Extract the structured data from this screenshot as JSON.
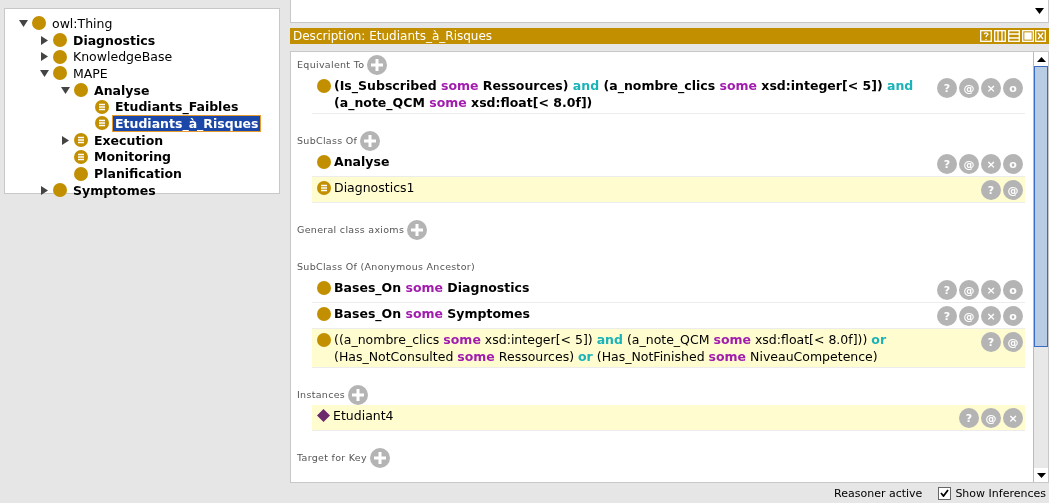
{
  "tree": [
    {
      "label": "owl:Thing",
      "kind": "class",
      "bold": false,
      "expanded": true,
      "selected": false,
      "children": [
        {
          "label": "Diagnostics",
          "kind": "class",
          "bold": true,
          "expanded": false,
          "selected": false
        },
        {
          "label": "KnowledgeBase",
          "kind": "class",
          "bold": false,
          "expanded": false,
          "selected": false
        },
        {
          "label": "MAPE",
          "kind": "class",
          "bold": false,
          "expanded": true,
          "selected": false,
          "children": [
            {
              "label": "Analyse",
              "kind": "class",
              "bold": true,
              "expanded": true,
              "selected": false,
              "children": [
                {
                  "label": "Etudiants_Faibles",
                  "kind": "defined",
                  "bold": true,
                  "selected": false
                },
                {
                  "label": "Etudiants_à_Risques",
                  "kind": "defined",
                  "bold": true,
                  "selected": true
                }
              ]
            },
            {
              "label": "Execution",
              "kind": "defined",
              "bold": true,
              "expanded": false,
              "selected": false
            },
            {
              "label": "Monitoring",
              "kind": "defined",
              "bold": true,
              "selected": false
            },
            {
              "label": "Planification",
              "kind": "class",
              "bold": true,
              "selected": false
            }
          ]
        },
        {
          "label": "Symptomes",
          "kind": "class",
          "bold": true,
          "expanded": false,
          "selected": false
        }
      ]
    }
  ],
  "description": {
    "title": "Description: Etudiants_à_Risques",
    "sections": [
      {
        "title": "Equivalent To",
        "add": true,
        "rows": [
          {
            "kind": "class",
            "bold": true,
            "inferred": false,
            "buttons": [
              "?",
              "@",
              "×",
              "o"
            ],
            "lines": [
              [
                {
                  "text": "(Is_Subscribed ",
                  "kind": "name"
                },
                {
                  "text": "some",
                  "kind": "some"
                },
                {
                  "text": " Ressources) ",
                  "kind": "name"
                },
                {
                  "text": "and",
                  "kind": "and"
                },
                {
                  "text": " (a_nombre_clics ",
                  "kind": "name"
                },
                {
                  "text": "some",
                  "kind": "some"
                },
                {
                  "text": " xsd:integer[< 5]) ",
                  "kind": "name"
                },
                {
                  "text": "and",
                  "kind": "and"
                }
              ],
              [
                {
                  "text": "(a_note_QCM ",
                  "kind": "name"
                },
                {
                  "text": "some",
                  "kind": "some"
                },
                {
                  "text": " xsd:float[< 8.0f])",
                  "kind": "name"
                }
              ]
            ]
          }
        ]
      },
      {
        "title": "SubClass Of",
        "add": true,
        "rows": [
          {
            "kind": "class",
            "bold": true,
            "inferred": false,
            "buttons": [
              "?",
              "@",
              "×",
              "o"
            ],
            "lines": [
              [
                {
                  "text": "Analyse",
                  "kind": "name"
                }
              ]
            ]
          },
          {
            "kind": "defined",
            "bold": false,
            "inferred": true,
            "buttons": [
              "?",
              "@"
            ],
            "lines": [
              [
                {
                  "text": "Diagnostics1",
                  "kind": "name"
                }
              ]
            ]
          }
        ]
      },
      {
        "title": "General class axioms",
        "add": true
      },
      {
        "title": "SubClass Of (Anonymous Ancestor)",
        "add": false,
        "rows": [
          {
            "kind": "class",
            "bold": true,
            "inferred": false,
            "buttons": [
              "?",
              "@",
              "×",
              "o"
            ],
            "lines": [
              [
                {
                  "text": "Bases_On ",
                  "kind": "name"
                },
                {
                  "text": "some",
                  "kind": "some"
                },
                {
                  "text": "  Diagnostics",
                  "kind": "name"
                }
              ]
            ]
          },
          {
            "kind": "class",
            "bold": true,
            "inferred": false,
            "buttons": [
              "?",
              "@",
              "×",
              "o"
            ],
            "lines": [
              [
                {
                  "text": "Bases_On ",
                  "kind": "name"
                },
                {
                  "text": "some",
                  "kind": "some"
                },
                {
                  "text": " Symptomes",
                  "kind": "name"
                }
              ]
            ]
          },
          {
            "kind": "class",
            "bold": false,
            "inferred": true,
            "buttons": [
              "?",
              "@"
            ],
            "lines": [
              [
                {
                  "text": "((a_nombre_clics ",
                  "kind": "name"
                },
                {
                  "text": "some",
                  "kind": "some"
                },
                {
                  "text": " xsd:integer[< 5]) ",
                  "kind": "name"
                },
                {
                  "text": "and",
                  "kind": "and"
                },
                {
                  "text": " (a_note_QCM ",
                  "kind": "name"
                },
                {
                  "text": "some",
                  "kind": "some"
                },
                {
                  "text": " xsd:float[< 8.0f])) ",
                  "kind": "name"
                },
                {
                  "text": "or",
                  "kind": "and"
                }
              ],
              [
                {
                  "text": "(Has_NotConsulted ",
                  "kind": "name"
                },
                {
                  "text": "some",
                  "kind": "some"
                },
                {
                  "text": " Ressources) ",
                  "kind": "name"
                },
                {
                  "text": "or",
                  "kind": "and"
                },
                {
                  "text": " (Has_NotFinished ",
                  "kind": "name"
                },
                {
                  "text": "some",
                  "kind": "some"
                },
                {
                  "text": " NiveauCompetence)",
                  "kind": "name"
                }
              ]
            ]
          }
        ]
      },
      {
        "title": "Instances",
        "add": true,
        "rows": [
          {
            "kind": "individual",
            "bold": false,
            "inferred": true,
            "buttons": [
              "?",
              "@",
              "×"
            ],
            "lines": [
              [
                {
                  "text": "Etudiant4",
                  "kind": "name"
                }
              ]
            ]
          }
        ]
      },
      {
        "title": "Target for Key",
        "add": true
      }
    ]
  },
  "status_bar": {
    "reasoner": "Reasoner active",
    "show_inferences": {
      "label": "Show Inferences",
      "checked": true
    }
  }
}
